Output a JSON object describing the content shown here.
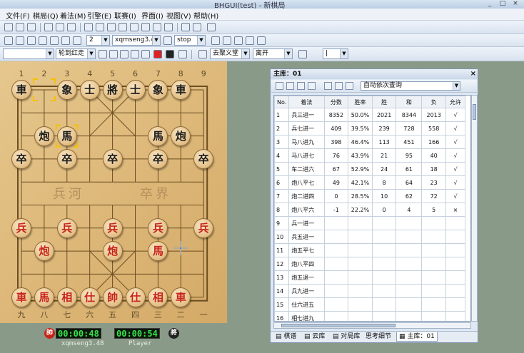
{
  "window": {
    "title": "BHGUI(test) - 新棋局",
    "controls": [
      "_",
      "□",
      "×"
    ]
  },
  "menu": [
    "文件(F)",
    "棋局(Q)",
    "着法(M)",
    "引擎(E)",
    "联赛(I)",
    "界面(I)",
    "视图(V)",
    "帮助(H)"
  ],
  "toolbar2": {
    "threads": "2",
    "engine": "xqmseng3.48",
    "stop": "stop"
  },
  "toolbar3": {
    "mode": "轮到红走",
    "opening": "去聚义堂",
    "leave": "离开",
    "level": "|"
  },
  "board": {
    "top_numbers": [
      "1",
      "2",
      "3",
      "4",
      "5",
      "6",
      "7",
      "8",
      "9"
    ],
    "bottom_numbers": [
      "九",
      "八",
      "七",
      "六",
      "五",
      "四",
      "三",
      "二",
      "一"
    ],
    "river_left": "兵河",
    "river_right": "卒界",
    "pieces": [
      {
        "ch": "車",
        "side": "black",
        "file": 0,
        "rank": 0
      },
      {
        "ch": "象",
        "side": "black",
        "file": 2,
        "rank": 0
      },
      {
        "ch": "士",
        "side": "black",
        "file": 3,
        "rank": 0
      },
      {
        "ch": "將",
        "side": "black",
        "file": 4,
        "rank": 0
      },
      {
        "ch": "士",
        "side": "black",
        "file": 5,
        "rank": 0
      },
      {
        "ch": "象",
        "side": "black",
        "file": 6,
        "rank": 0
      },
      {
        "ch": "車",
        "side": "black",
        "file": 7,
        "rank": 0
      },
      {
        "ch": "炮",
        "side": "black",
        "file": 1,
        "rank": 2
      },
      {
        "ch": "馬",
        "side": "black",
        "file": 2,
        "rank": 2
      },
      {
        "ch": "馬",
        "side": "black",
        "file": 6,
        "rank": 2
      },
      {
        "ch": "炮",
        "side": "black",
        "file": 7,
        "rank": 2
      },
      {
        "ch": "卒",
        "side": "black",
        "file": 0,
        "rank": 3
      },
      {
        "ch": "卒",
        "side": "black",
        "file": 2,
        "rank": 3
      },
      {
        "ch": "卒",
        "side": "black",
        "file": 4,
        "rank": 3
      },
      {
        "ch": "卒",
        "side": "black",
        "file": 6,
        "rank": 3
      },
      {
        "ch": "卒",
        "side": "black",
        "file": 8,
        "rank": 3
      },
      {
        "ch": "兵",
        "side": "red",
        "file": 0,
        "rank": 6
      },
      {
        "ch": "兵",
        "side": "red",
        "file": 2,
        "rank": 6
      },
      {
        "ch": "兵",
        "side": "red",
        "file": 4,
        "rank": 6
      },
      {
        "ch": "兵",
        "side": "red",
        "file": 6,
        "rank": 6
      },
      {
        "ch": "兵",
        "side": "red",
        "file": 8,
        "rank": 6
      },
      {
        "ch": "炮",
        "side": "red",
        "file": 1,
        "rank": 7
      },
      {
        "ch": "炮",
        "side": "red",
        "file": 4,
        "rank": 7
      },
      {
        "ch": "馬",
        "side": "red",
        "file": 6,
        "rank": 7
      },
      {
        "ch": "車",
        "side": "red",
        "file": 0,
        "rank": 9
      },
      {
        "ch": "馬",
        "side": "red",
        "file": 1,
        "rank": 9
      },
      {
        "ch": "相",
        "side": "red",
        "file": 2,
        "rank": 9
      },
      {
        "ch": "仕",
        "side": "red",
        "file": 3,
        "rank": 9
      },
      {
        "ch": "帥",
        "side": "red",
        "file": 4,
        "rank": 9
      },
      {
        "ch": "仕",
        "side": "red",
        "file": 5,
        "rank": 9
      },
      {
        "ch": "相",
        "side": "red",
        "file": 6,
        "rank": 9
      },
      {
        "ch": "車",
        "side": "red",
        "file": 7,
        "rank": 9
      }
    ],
    "last_move_markers": [
      {
        "file": 1,
        "rank": 0
      },
      {
        "file": 2,
        "rank": 2
      }
    ]
  },
  "clock": {
    "red_badge": "帥",
    "red_time": "00:00:48",
    "black_time": "00:00:54",
    "black_badge": "將",
    "red_name": "xqmseng3.48",
    "black_name": "Player"
  },
  "panel": {
    "title": "主库：01",
    "query": "自动依次查询",
    "columns": [
      "No.",
      "着法",
      "分数",
      "胜率",
      "胜",
      "和",
      "负",
      "允许"
    ],
    "rows": [
      [
        "1",
        "兵三进一",
        "8352",
        "50.0%",
        "2021",
        "8344",
        "2013",
        "√"
      ],
      [
        "2",
        "兵七进一",
        "409",
        "39.5%",
        "239",
        "728",
        "558",
        "√"
      ],
      [
        "3",
        "马八进九",
        "398",
        "46.4%",
        "113",
        "451",
        "166",
        "√"
      ],
      [
        "4",
        "马八进七",
        "76",
        "43.9%",
        "21",
        "95",
        "40",
        "√"
      ],
      [
        "5",
        "车二进六",
        "67",
        "52.9%",
        "24",
        "61",
        "18",
        "√"
      ],
      [
        "6",
        "炮八平七",
        "49",
        "42.1%",
        "8",
        "64",
        "23",
        "√"
      ],
      [
        "7",
        "炮二进四",
        "0",
        "28.5%",
        "10",
        "62",
        "72",
        "√"
      ],
      [
        "8",
        "炮八平六",
        "-1",
        "22.2%",
        "0",
        "4",
        "5",
        "×"
      ],
      [
        "9",
        "兵一进一",
        "",
        "",
        "",
        "",
        "",
        ""
      ],
      [
        "10",
        "兵五进一",
        "",
        "",
        "",
        "",
        "",
        ""
      ],
      [
        "11",
        "炮五平七",
        "",
        "",
        "",
        "",
        "",
        ""
      ],
      [
        "12",
        "炮八平四",
        "",
        "",
        "",
        "",
        "",
        ""
      ],
      [
        "13",
        "炮五退一",
        "",
        "",
        "",
        "",
        "",
        ""
      ],
      [
        "14",
        "兵九进一",
        "",
        "",
        "",
        "",
        "",
        ""
      ],
      [
        "15",
        "仕六进五",
        "",
        "",
        "",
        "",
        "",
        ""
      ],
      [
        "16",
        "相七进九",
        "",
        "",
        "",
        "",
        "",
        ""
      ]
    ],
    "tabs": [
      "棋谱",
      "云库",
      "对局库",
      "思考细节",
      "主库：01"
    ]
  }
}
